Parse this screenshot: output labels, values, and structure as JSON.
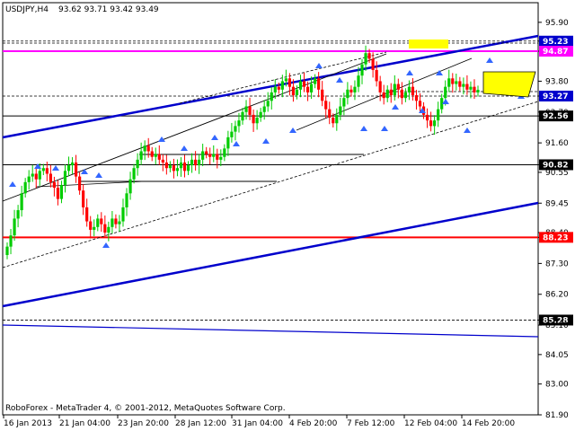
{
  "header": {
    "symbol": "USDJPY,H4",
    "ohlc": "93.62 93.71 93.42 93.49"
  },
  "footer": {
    "copyright": "RoboForex - MetaTrader 4, © 2001-2012, MetaQuotes Software Corp."
  },
  "colors": {
    "bull": "#00cc00",
    "bear": "#ff0000",
    "trend": "#0000cc",
    "magenta": "#ff00ff",
    "red_level": "#ff0000",
    "highlight": "#ffff00",
    "arrow": "#3366ff"
  },
  "chart_data": {
    "type": "candlestick",
    "x_ticks": [
      "16 Jan 2013",
      "21 Jan 04:00",
      "23 Jan 20:00",
      "28 Jan 12:00",
      "31 Jan 04:00",
      "4 Feb 20:00",
      "7 Feb 12:00",
      "12 Feb 04:00",
      "14 Feb 20:00"
    ],
    "y_ticks": [
      "95.90",
      "95.23",
      "94.87",
      "93.80",
      "93.27",
      "92.70",
      "92.56",
      "91.60",
      "90.82",
      "90.55",
      "89.45",
      "88.40",
      "88.23",
      "87.30",
      "86.20",
      "85.28",
      "85.10",
      "84.05",
      "83.00",
      "81.90"
    ],
    "ylim": [
      81.9,
      96.6
    ],
    "highlighted_levels": [
      {
        "label": "95.23",
        "value": 95.23,
        "style": "blue"
      },
      {
        "label": "94.87",
        "value": 94.87,
        "style": "magenta"
      },
      {
        "label": "93.27",
        "value": 93.27,
        "style": "blue"
      },
      {
        "label": "92.56",
        "value": 92.56,
        "style": "black"
      },
      {
        "label": "90.82",
        "value": 90.82,
        "style": "black"
      },
      {
        "label": "88.23",
        "value": 88.23,
        "style": "red"
      },
      {
        "label": "85.28",
        "value": 85.28,
        "style": "dashed"
      }
    ],
    "closes": [
      87.9,
      88.3,
      88.9,
      89.2,
      89.8,
      90.2,
      90.4,
      90.5,
      90.3,
      90.6,
      90.7,
      90.5,
      90.2,
      90.0,
      89.6,
      90.1,
      90.6,
      90.8,
      90.9,
      90.4,
      89.9,
      89.3,
      88.8,
      88.5,
      88.6,
      88.9,
      88.7,
      88.4,
      88.6,
      88.9,
      88.7,
      88.8,
      89.3,
      89.8,
      90.3,
      90.7,
      91.0,
      91.3,
      91.5,
      91.3,
      91.1,
      91.2,
      91.0,
      90.9,
      90.7,
      90.8,
      90.6,
      90.7,
      90.9,
      90.6,
      90.8,
      91.0,
      90.8,
      91.0,
      91.3,
      91.2,
      91.1,
      91.2,
      91.0,
      91.1,
      91.4,
      91.8,
      92.0,
      92.2,
      92.4,
      92.7,
      92.9,
      92.6,
      92.3,
      92.5,
      92.7,
      92.9,
      93.1,
      93.4,
      93.6,
      93.5,
      93.8,
      93.9,
      93.6,
      93.3,
      93.5,
      93.8,
      93.6,
      93.4,
      93.7,
      93.9,
      93.5,
      93.1,
      92.8,
      92.5,
      92.3,
      92.6,
      92.9,
      93.2,
      93.5,
      93.4,
      93.6,
      94.0,
      94.4,
      94.8,
      94.6,
      94.2,
      93.8,
      93.4,
      93.2,
      93.5,
      93.3,
      93.7,
      93.5,
      93.2,
      93.4,
      93.6,
      93.3,
      93.1,
      92.9,
      92.6,
      92.4,
      92.2,
      92.4,
      92.8,
      93.2,
      93.6,
      93.9,
      93.7,
      93.8,
      93.6,
      93.7,
      93.5,
      93.6,
      93.4,
      93.49
    ]
  }
}
